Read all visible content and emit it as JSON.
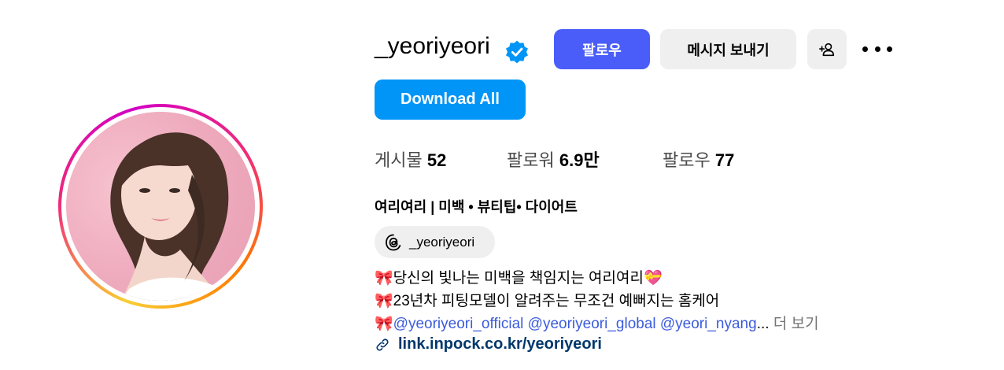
{
  "profile": {
    "username": "_yeoriyeori",
    "follow_label": "팔로우",
    "message_label": "메시지 보내기",
    "download_label": "Download All"
  },
  "stats": {
    "posts_label": "게시물",
    "posts_value": "52",
    "followers_label": "팔로워",
    "followers_value": "6.9만",
    "following_label": "팔로우",
    "following_value": "77"
  },
  "bio": {
    "name": "여리여리 | 미백 • 뷰티팁• 다이어트",
    "threads_handle": "_yeoriyeori",
    "line1_text": "당신의 빛나는 미백을 책임지는 여리여리",
    "line2_text": "23년차 피팅모델이 알려주는 무조건 예뻐지는 홈케어",
    "line3_mentions": "@yeoriyeori_official @yeoriyeori_global @yeori_nyang",
    "line3_ellipsis": "...",
    "more_label": "더 보기",
    "link": "link.inpock.co.kr/yeoriyeori",
    "emoji_bow": "🎀",
    "emoji_heart": "💝"
  },
  "colors": {
    "follow_button": "#4a5df9",
    "download_button": "#0095f6",
    "mention": "#3b5bdb",
    "link": "#00376b"
  },
  "icons": {
    "verified": "verified-badge-icon",
    "add_user": "add-user-icon",
    "more": "more-options-icon",
    "threads": "threads-icon",
    "link": "link-icon"
  }
}
